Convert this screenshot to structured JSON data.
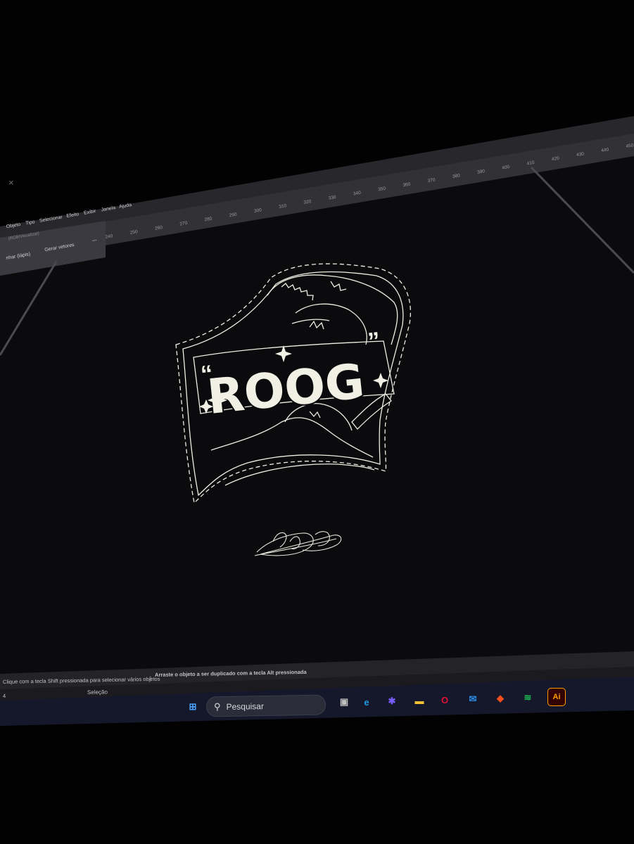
{
  "app": {
    "menu": [
      "Objeto",
      "Tipo",
      "Selecionar",
      "Efeito",
      "Exibir",
      "Janela",
      "Ajuda"
    ],
    "doc_tab": "(RGB/Visualizar)",
    "tool_label": "nhar (lápis)",
    "generate_button": "Gerar vetores",
    "more_button": "•••",
    "ruler_ticks": [
      "240",
      "250",
      "260",
      "270",
      "280",
      "290",
      "300",
      "310",
      "320",
      "330",
      "340",
      "350",
      "360",
      "370",
      "380",
      "390",
      "400",
      "410",
      "420",
      "430",
      "440",
      "450"
    ],
    "close_glyph": "×"
  },
  "artwork": {
    "logo_text": "ROOG",
    "logo_outline": "#f1f0e4",
    "signature_color": "#e8e6dc"
  },
  "status_bar": {
    "hint_left": "Clique com a tecla Shift pressionada para selecionar vários objetos",
    "separator": "|",
    "hint_right": "Arraste o objeto a ser duplicado com a tecla Alt pressionada",
    "zoom_value": "4",
    "mode": "Seleção"
  },
  "taskbar": {
    "search_placeholder": "Pesquisar",
    "apps": [
      {
        "name": "windows-start-icon",
        "glyph": "⊞",
        "color": "#4aa3ff"
      },
      {
        "name": "task-view-icon",
        "glyph": "▣",
        "color": "#bfbfbf"
      },
      {
        "name": "edge-icon",
        "glyph": "e",
        "color": "#1f9be0"
      },
      {
        "name": "copilot-icon",
        "glyph": "✱",
        "color": "#7b5cff"
      },
      {
        "name": "file-explorer-icon",
        "glyph": "▬",
        "color": "#f2c230"
      },
      {
        "name": "opera-icon",
        "glyph": "O",
        "color": "#e0103a"
      },
      {
        "name": "mail-icon",
        "glyph": "✉",
        "color": "#2b8ce6"
      },
      {
        "name": "figma-icon",
        "glyph": "◆",
        "color": "#f24e1e"
      },
      {
        "name": "spotify-icon",
        "glyph": "≋",
        "color": "#1db954"
      },
      {
        "name": "illustrator-icon",
        "glyph": "Ai",
        "color": "#ff9a00"
      }
    ]
  }
}
